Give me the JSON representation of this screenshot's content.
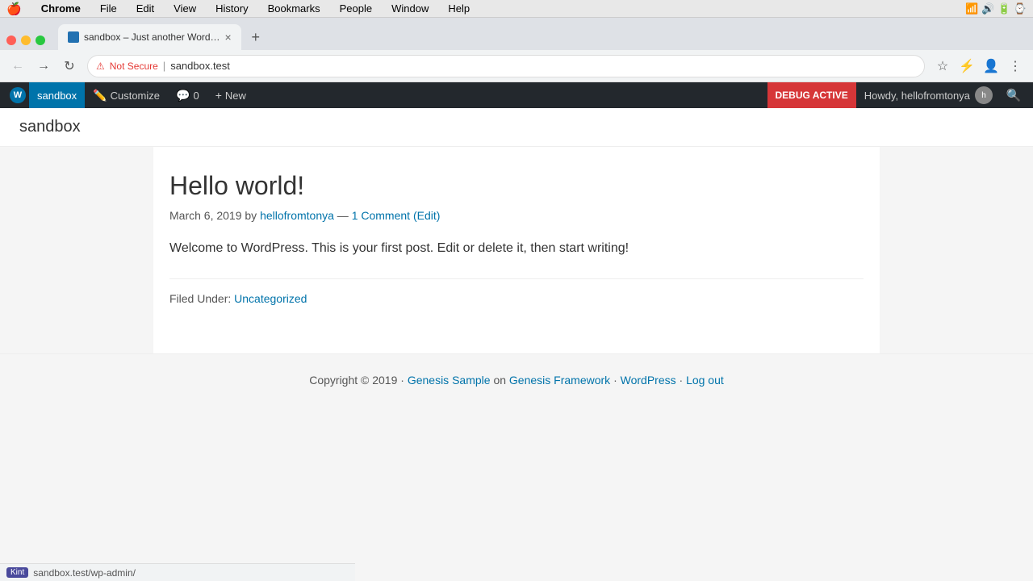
{
  "macos": {
    "apple": "🍎",
    "menus": [
      "Chrome",
      "File",
      "Edit",
      "View",
      "History",
      "Bookmarks",
      "People",
      "Window",
      "Help"
    ]
  },
  "browser": {
    "tab": {
      "title": "sandbox – Just another Word…",
      "favicon_label": "WP"
    },
    "address_bar": {
      "not_secure": "Not Secure",
      "separator": "|",
      "url": "sandbox.test"
    },
    "toolbar": {
      "back": "←",
      "forward": "→",
      "reload": "↻"
    }
  },
  "wp_admin_bar": {
    "wp_logo": "W",
    "items": [
      {
        "id": "sandbox",
        "label": "sandbox",
        "active": true
      },
      {
        "id": "customize",
        "label": "Customize",
        "icon": "✏️"
      },
      {
        "id": "comments",
        "label": "0",
        "icon": "💬"
      },
      {
        "id": "new",
        "label": "New",
        "icon": "+"
      }
    ],
    "debug_active": "DEBUG ACTIVE",
    "howdy": "Howdy, hellofromtonya"
  },
  "site": {
    "title": "sandbox",
    "post": {
      "title": "Hello world!",
      "date": "March 6, 2019",
      "author": "hellofromtonya",
      "author_link": "#",
      "dash": "—",
      "comments": "1 Comment",
      "edit": "(Edit)",
      "content": "Welcome to WordPress. This is your first post. Edit or delete it, then start writing!",
      "filed_under_label": "Filed Under:",
      "category": "Uncategorized"
    },
    "footer": {
      "copyright": "Copyright © 2019 ·",
      "genesis_sample": "Genesis Sample",
      "on": "on",
      "genesis_framework": "Genesis Framework",
      "dot1": "·",
      "wordpress": "WordPress",
      "dot2": "·",
      "logout": "Log out"
    }
  },
  "status_bar": {
    "kint": "Kint",
    "url": "sandbox.test/wp-admin/"
  }
}
